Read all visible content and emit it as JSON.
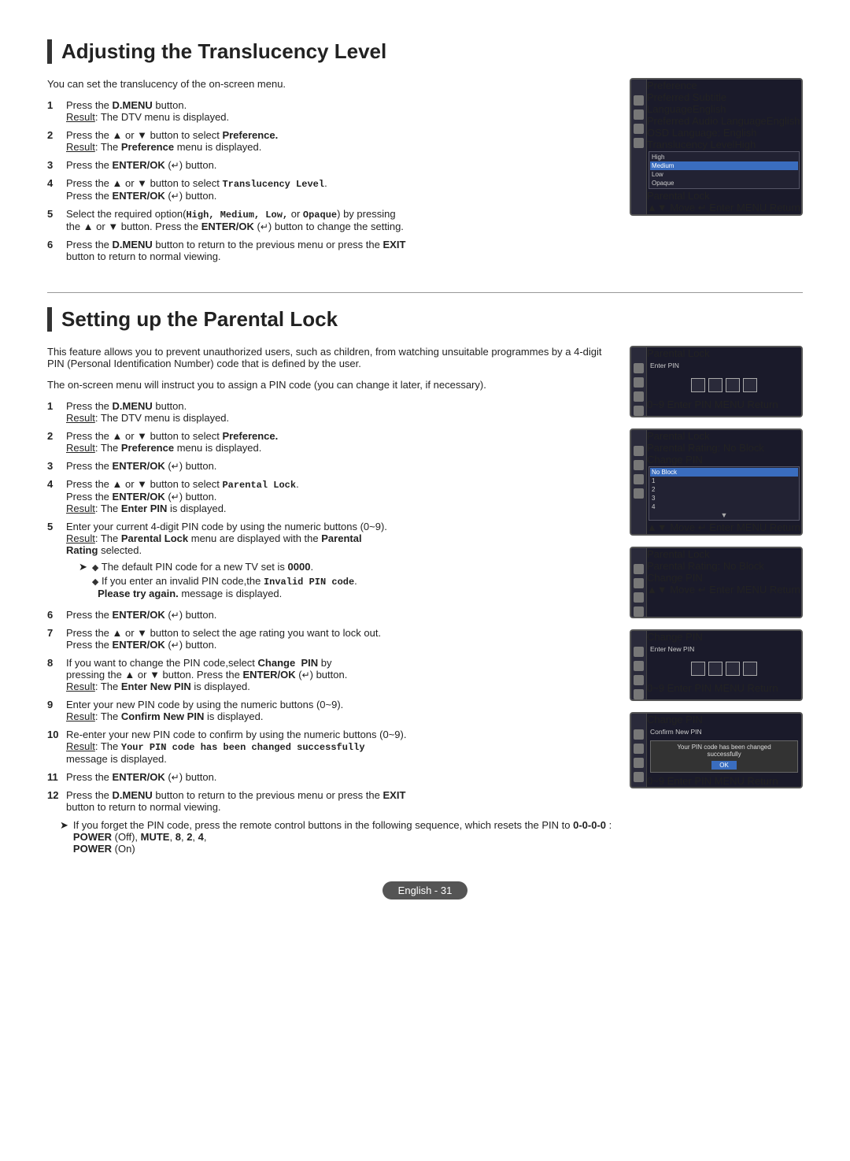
{
  "section1": {
    "title": "Adjusting the Translucency Level",
    "intro": "You can set the translucency of the on-screen menu.",
    "steps": [
      {
        "num": "1",
        "text": "Press the ",
        "bold": "D.MENU",
        "text2": " button.",
        "result": "Result",
        "result_text": ": The DTV menu is displayed."
      },
      {
        "num": "2",
        "text": "Press the ▲ or ▼ button to select ",
        "bold": "Preference.",
        "result": "Result",
        "result_text": ": The ",
        "bold2": "Preference",
        "text2": " menu is displayed."
      },
      {
        "num": "3",
        "text": "Press the ",
        "bold": "ENTER/OK",
        "text2": " (",
        "symbol": "↵",
        "text3": ") button."
      },
      {
        "num": "4",
        "text": "Press the ▲ or ▼ button to select ",
        "mono": "Translucency Level",
        "text2": ".",
        "newline": "Press the ",
        "bold": "ENTER/OK",
        "text3": " (",
        "symbol": "↵",
        "text4": ") button."
      },
      {
        "num": "5",
        "text": "Select the required option(",
        "mono": "High, Medium, Low,",
        "text2": " or ",
        "mono2": "Opaque",
        "text3": ") by pressing",
        "newline": "the ▲ or ▼ button. Press the ",
        "bold": "ENTER/OK",
        "text4": " (",
        "symbol": "↵",
        "text5": ") button to change the setting."
      },
      {
        "num": "6",
        "text": "Press the ",
        "bold": "D.MENU",
        "text2": " button to return to the previous menu or press the ",
        "bold2": "EXIT",
        "text3": " button to return to normal viewing."
      }
    ]
  },
  "section2": {
    "title": "Setting up the Parental Lock",
    "intro1": "This feature allows you to prevent unauthorized users, such as children, from watching unsuitable programmes by a 4-digit PIN (Personal Identification Number) code that is defined by the user.",
    "intro2": "The on-screen menu will instruct you to assign a PIN code (you can change it later, if necessary).",
    "steps": [
      {
        "num": "1",
        "text": "Press the ",
        "bold": "D.MENU",
        "text2": " button.",
        "result": "Result",
        "result_text": ": The DTV menu is displayed."
      },
      {
        "num": "2",
        "text": "Press the ▲ or ▼ button to select ",
        "bold": "Preference.",
        "result": "Result",
        "result_text": ": The ",
        "bold2": "Preference",
        "text2": " menu is displayed."
      },
      {
        "num": "3",
        "text": "Press the ",
        "bold": "ENTER/OK",
        "text2": " (",
        "symbol": "↵",
        "text3": ") button."
      },
      {
        "num": "4",
        "text": "Press the ▲ or ▼ button to select ",
        "mono": "Parental Lock",
        "text2": ".",
        "newline": "Press the ",
        "bold": "ENTER/OK",
        "text3": " (",
        "symbol": "↵",
        "text4": ") button.",
        "result": "Result",
        "result_text": ": The ",
        "bold2": "Enter PIN",
        "text5": " is displayed."
      },
      {
        "num": "5",
        "text": "Enter your current 4-digit PIN code by using the numeric buttons (0~9).",
        "result": "Result",
        "result_text": ": The ",
        "bold2": "Parental Lock",
        "text2": " menu are displayed with the ",
        "bold3": "Parental",
        "newline2": "Rating",
        "text3": " selected."
      },
      {
        "num": "6",
        "text": "Press the ",
        "bold": "ENTER/OK",
        "text2": " (",
        "symbol": "↵",
        "text3": ") button."
      },
      {
        "num": "7",
        "text": "Press the ▲ or ▼ button to select the age rating you want to lock out. Press the ",
        "bold": "ENTER/OK",
        "text2": " (",
        "symbol": "↵",
        "text3": ") button."
      },
      {
        "num": "8",
        "text": "If you want to change the PIN code,select ",
        "bold": "Change  PIN",
        "text2": " by pressing the ▲ or ▼ button. Press the ",
        "bold2": "ENTER/OK",
        "text3": " (",
        "symbol": "↵",
        "text4": ") button.",
        "result": "Result",
        "result_text": ": The ",
        "bold3": "Enter New PIN",
        "text5": " is displayed."
      },
      {
        "num": "9",
        "text": "Enter your new PIN code by using the numeric buttons (0~9).",
        "result": "Result",
        "result_text": ": The ",
        "bold2": "Confirm New PIN",
        "text2": " is displayed."
      },
      {
        "num": "10",
        "text": "Re-enter your new PIN code to confirm by using the numeric buttons (0~9).",
        "result": "Result",
        "result_text": ": The ",
        "mono": "Your PIN code has been changed successfully",
        "text2": " message is displayed."
      },
      {
        "num": "11",
        "text": "Press the ",
        "bold": "ENTER/OK",
        "text2": " (",
        "symbol": "↵",
        "text3": ") button."
      },
      {
        "num": "12",
        "text": "Press the ",
        "bold": "D.MENU",
        "text2": " button to return to the previous menu or press the ",
        "bold2": "EXIT",
        "text3": " button to return to normal viewing."
      }
    ],
    "note": "If you forget the PIN code, press the remote control buttons in the following sequence, which resets the PIN to 0-0-0-0 : POWER (Off), MUTE, 8, 2, 4, POWER (On)",
    "subnote1": "The default PIN code for a new TV set is 0000.",
    "subnote2": "If you enter an invalid PIN code,the Invalid PIN code. Please try again. message is displayed."
  },
  "screen1": {
    "title": "Preference",
    "rows": [
      {
        "label": "Preferred Subtitle Language",
        "value": "English"
      },
      {
        "label": "Preferred Audio Language",
        "value": "English"
      },
      {
        "label": "OSD Language",
        "value": ": English"
      },
      {
        "label": "Translucency Level",
        "value": "High",
        "highlight": true
      },
      {
        "label": "Parental Lock",
        "value": ""
      }
    ],
    "dropdown": [
      "High",
      "Medium",
      "Low",
      "Opaque"
    ],
    "footer_left": "▲▼ Move",
    "footer_mid": "↵ Enter",
    "footer_right": "MENU Return"
  },
  "screen2": {
    "title": "Parental Lock",
    "label": "Enter PIN",
    "footer_left": "0~9 Enter PIN",
    "footer_right": "MENU Return"
  },
  "screen3": {
    "title": "Parental Lock",
    "rows": [
      {
        "label": "Parental Rating",
        "value": ": No Block"
      },
      {
        "label": "Change PIN",
        "value": ""
      }
    ],
    "dropdown": [
      "No Block",
      "1",
      "2",
      "3",
      "4"
    ],
    "footer_left": "▲▼ Move",
    "footer_mid": "↵ Enter",
    "footer_right": "MENU Return"
  },
  "screen4": {
    "title": "Parental Lock",
    "rows": [
      {
        "label": "Parental Rating",
        "value": ": No Block"
      },
      {
        "label": "Change PIN",
        "value": ""
      }
    ],
    "footer_left": "▲▼ Move",
    "footer_mid": "↵ Enter",
    "footer_right": "MENU Return"
  },
  "screen5": {
    "title": "Change PIN",
    "label": "Enter New PIN",
    "footer_left": "0~9 Enter PIN",
    "footer_right": "MENU Return"
  },
  "screen6": {
    "title": "Change PIN",
    "label": "Confirm New PIN",
    "message": "Your PIN code has been changed successfully",
    "ok_btn": "OK",
    "footer_left": "0~9 Enter PIN",
    "footer_right": "MENU Return"
  },
  "footer": {
    "text": "English - 31"
  }
}
